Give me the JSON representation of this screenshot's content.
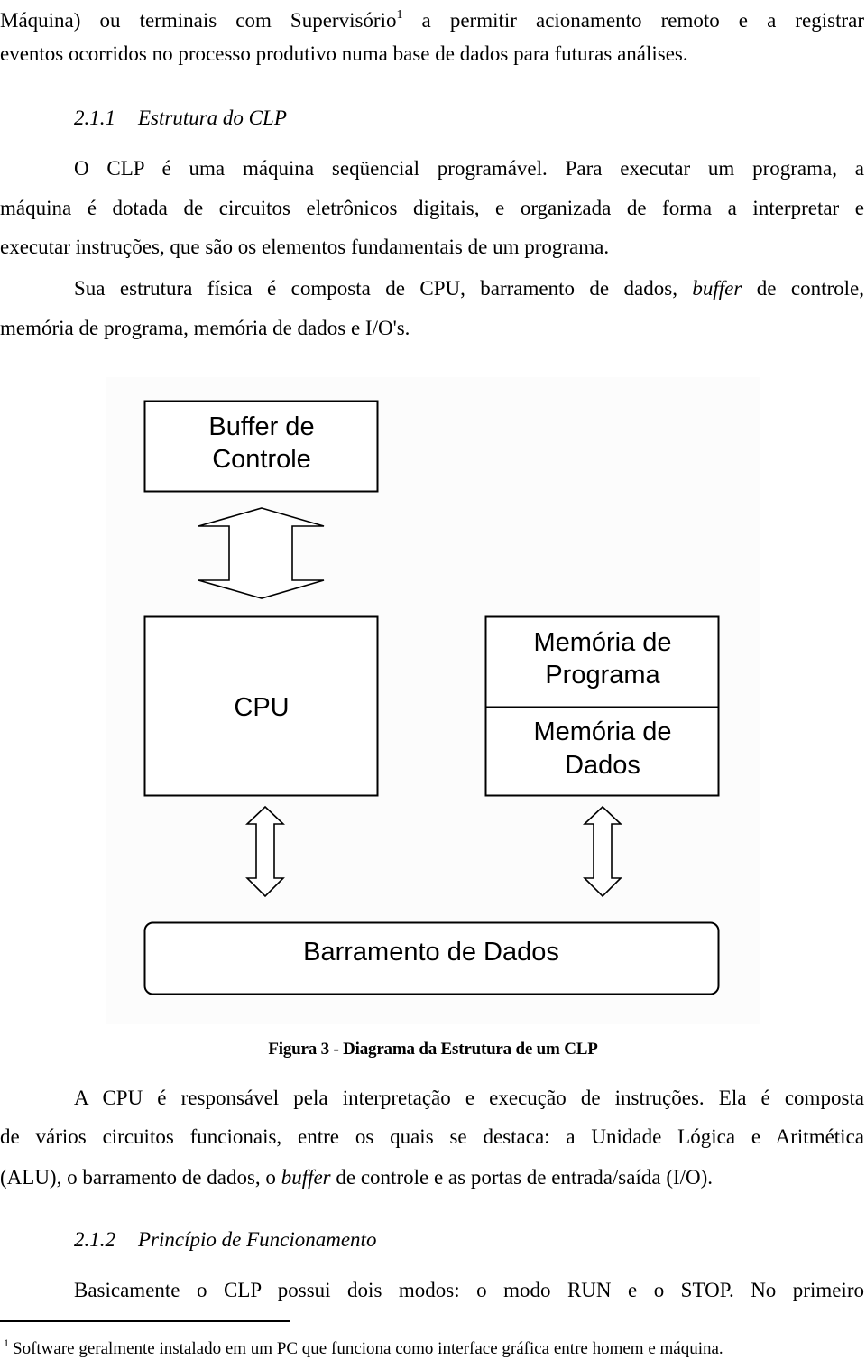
{
  "document": {
    "paragraph_intro": {
      "line1_a": "Máquina) ou terminais com Supervisório",
      "line1_sup": "1",
      "line1_b": " a permitir acionamento remoto e a registrar",
      "line2": "eventos ocorridos no processo produtivo numa base de dados para futuras análises."
    },
    "section_211": {
      "number": "2.1.1",
      "title": "Estrutura do CLP"
    },
    "paragraph_clp": {
      "line1": "O CLP é uma máquina seqüencial programável. Para executar um programa, a",
      "line2": "máquina é dotada de circuitos eletrônicos digitais, e organizada de forma a interpretar e",
      "line3": "executar instruções, que são os elementos fundamentais de um programa."
    },
    "paragraph_estrutura": {
      "line1_a": "Sua estrutura física é composta de CPU, barramento de dados, ",
      "line1_italic": "buffer",
      "line1_b": " de controle,",
      "line2": "memória de programa, memória de dados e I/O's."
    },
    "diagram": {
      "buffer_box": {
        "line1": "Buffer de",
        "line2": "Controle"
      },
      "cpu_box": {
        "label": "CPU"
      },
      "memory_program_box": {
        "line1": "Memória de",
        "line2": "Programa"
      },
      "memory_data_box": {
        "line1": "Memória de",
        "line2": "Dados"
      },
      "bus_box": {
        "label": "Barramento de Dados"
      }
    },
    "figure_caption": "Figura 3 - Diagrama da Estrutura de um CLP",
    "paragraph_cpu": {
      "line1": "A CPU é responsável pela interpretação e execução de instruções. Ela é composta",
      "line2": "de vários circuitos funcionais, entre os quais se destaca: a Unidade Lógica e Aritmética",
      "line3_a": "(ALU), o barramento de dados, o ",
      "line3_italic": "buffer",
      "line3_b": " de controle e as portas de entrada/saída (I/O)."
    },
    "section_212": {
      "number": "2.1.2",
      "title": "Princípio de Funcionamento"
    },
    "paragraph_modes": {
      "line1": "Basicamente o CLP possui dois modos: o modo RUN e o STOP. No primeiro"
    },
    "footnote": {
      "marker": "1",
      "text": "Software geralmente instalado em um PC que funciona como interface gráfica entre homem e máquina."
    }
  }
}
